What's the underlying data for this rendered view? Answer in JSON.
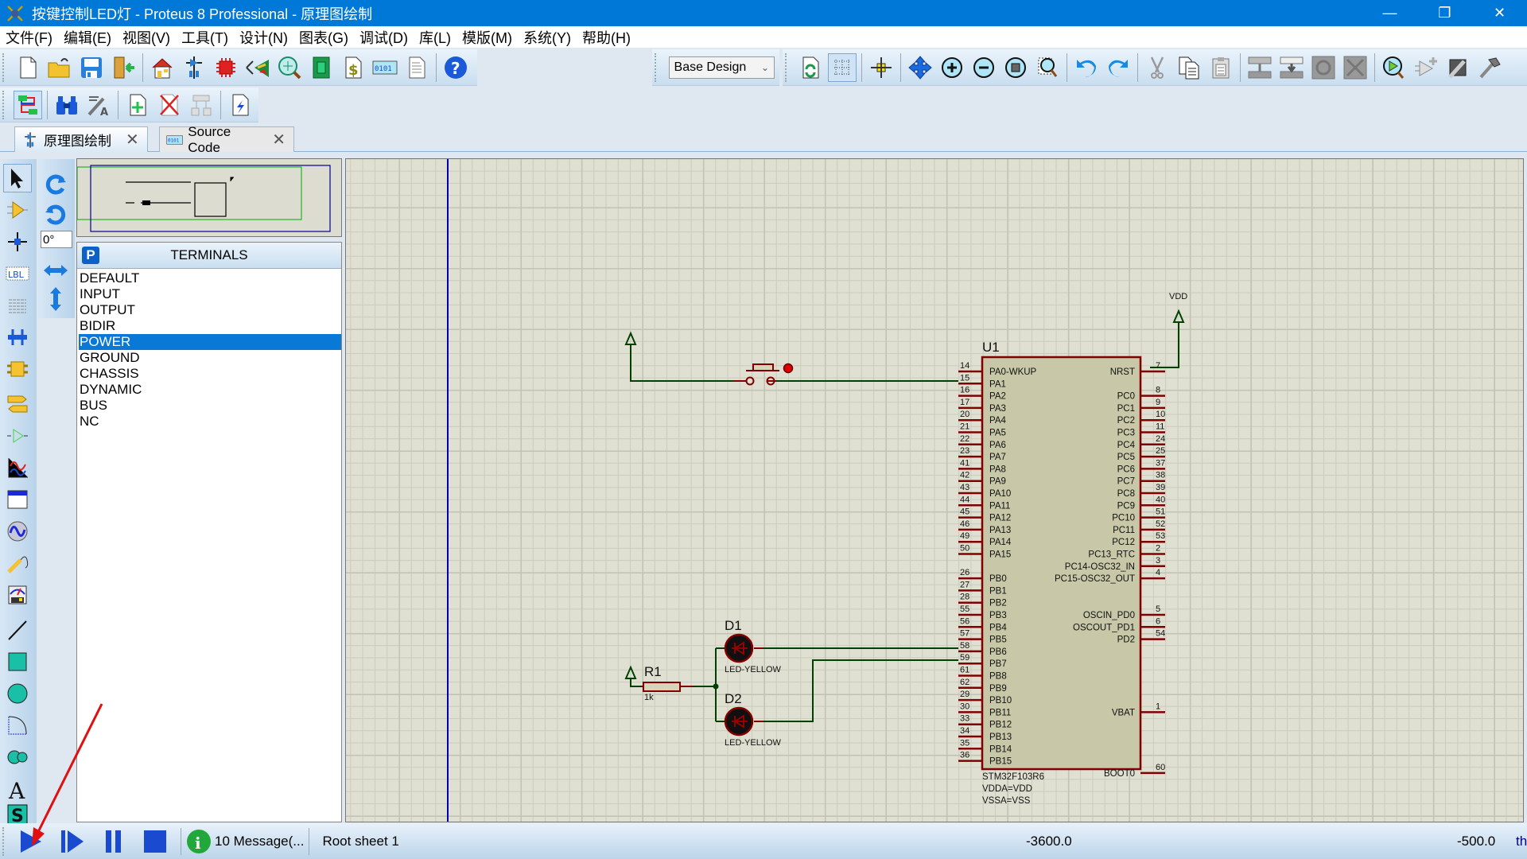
{
  "window": {
    "title": "按键控制LED灯 - Proteus 8 Professional - 原理图绘制",
    "minimize": "—",
    "restore": "❐",
    "close": "✕"
  },
  "menu": [
    "文件(F)",
    "编辑(E)",
    "视图(V)",
    "工具(T)",
    "设计(N)",
    "图表(G)",
    "调试(D)",
    "库(L)",
    "模版(M)",
    "系统(Y)",
    "帮助(H)"
  ],
  "toolbar": {
    "design_select": "Base Design",
    "row1_icons": [
      "new-file",
      "open-file",
      "save",
      "close-project",
      "home",
      "schematic-capture",
      "pcb-layout",
      "3d-visualizer",
      "gerber-viewer",
      "design-explorer",
      "bill-of-materials",
      "source-code",
      "notes",
      "help"
    ],
    "row1_right_icons": [
      "refresh",
      "grid-toggle",
      "origin",
      "pan",
      "zoom-in",
      "zoom-out",
      "zoom-all",
      "zoom-area",
      "undo",
      "redo",
      "cut",
      "copy",
      "paste",
      "block-copy",
      "block-move",
      "block-rotate",
      "block-delete",
      "pick-device",
      "make-device",
      "packaging-tool",
      "decompose"
    ],
    "row2_icons": [
      "sheet-navigation",
      "search",
      "property-assignment",
      "new-sheet",
      "remove-sheet",
      "goto-child-sheet",
      "electrical-rule-check"
    ]
  },
  "tabs": [
    {
      "label": "原理图绘制",
      "icon": "schematic-icon",
      "active": true
    },
    {
      "label": "Source Code",
      "icon": "source-code-icon",
      "active": false
    }
  ],
  "tools": {
    "rotation_angle": "0°",
    "left_tools": [
      "selection",
      "component",
      "junction-dot",
      "wire-label",
      "text-script",
      "buses",
      "subcircuit",
      "terminals",
      "device-pins",
      "graph",
      "active-popup",
      "generator",
      "probe",
      "virtual-instruments",
      "line",
      "box",
      "circle",
      "arc",
      "closed-path",
      "text",
      "symbol"
    ]
  },
  "terminals_panel": {
    "header_button": "P",
    "title": "TERMINALS",
    "items": [
      "DEFAULT",
      "INPUT",
      "OUTPUT",
      "BIDIR",
      "POWER",
      "GROUND",
      "CHASSIS",
      "DYNAMIC",
      "BUS",
      "NC"
    ],
    "selected": "POWER"
  },
  "schematic": {
    "u1": {
      "ref": "U1",
      "part": "STM32F103R6",
      "props": [
        "VDDA=VDD",
        "VSSA=VSS"
      ],
      "left_pins": [
        {
          "num": "14",
          "name": "PA0-WKUP"
        },
        {
          "num": "15",
          "name": "PA1"
        },
        {
          "num": "16",
          "name": "PA2"
        },
        {
          "num": "17",
          "name": "PA3"
        },
        {
          "num": "20",
          "name": "PA4"
        },
        {
          "num": "21",
          "name": "PA5"
        },
        {
          "num": "22",
          "name": "PA6"
        },
        {
          "num": "23",
          "name": "PA7"
        },
        {
          "num": "41",
          "name": "PA8"
        },
        {
          "num": "42",
          "name": "PA9"
        },
        {
          "num": "43",
          "name": "PA10"
        },
        {
          "num": "44",
          "name": "PA11"
        },
        {
          "num": "45",
          "name": "PA12"
        },
        {
          "num": "46",
          "name": "PA13"
        },
        {
          "num": "49",
          "name": "PA14"
        },
        {
          "num": "50",
          "name": "PA15"
        },
        null,
        {
          "num": "26",
          "name": "PB0"
        },
        {
          "num": "27",
          "name": "PB1"
        },
        {
          "num": "28",
          "name": "PB2"
        },
        {
          "num": "55",
          "name": "PB3"
        },
        {
          "num": "56",
          "name": "PB4"
        },
        {
          "num": "57",
          "name": "PB5"
        },
        {
          "num": "58",
          "name": "PB6"
        },
        {
          "num": "59",
          "name": "PB7"
        },
        {
          "num": "61",
          "name": "PB8"
        },
        {
          "num": "62",
          "name": "PB9"
        },
        {
          "num": "29",
          "name": "PB10"
        },
        {
          "num": "30",
          "name": "PB11"
        },
        {
          "num": "33",
          "name": "PB12"
        },
        {
          "num": "34",
          "name": "PB13"
        },
        {
          "num": "35",
          "name": "PB14"
        },
        {
          "num": "36",
          "name": "PB15"
        }
      ],
      "right_pins": [
        {
          "num": "7",
          "name": "NRST"
        },
        null,
        {
          "num": "8",
          "name": "PC0"
        },
        {
          "num": "9",
          "name": "PC1"
        },
        {
          "num": "10",
          "name": "PC2"
        },
        {
          "num": "11",
          "name": "PC3"
        },
        {
          "num": "24",
          "name": "PC4"
        },
        {
          "num": "25",
          "name": "PC5"
        },
        {
          "num": "37",
          "name": "PC6"
        },
        {
          "num": "38",
          "name": "PC7"
        },
        {
          "num": "39",
          "name": "PC8"
        },
        {
          "num": "40",
          "name": "PC9"
        },
        {
          "num": "51",
          "name": "PC10"
        },
        {
          "num": "52",
          "name": "PC11"
        },
        {
          "num": "53",
          "name": "PC12"
        },
        {
          "num": "2",
          "name": "PC13_RTC"
        },
        {
          "num": "3",
          "name": "PC14-OSC32_IN"
        },
        {
          "num": "4",
          "name": "PC15-OSC32_OUT"
        },
        null,
        null,
        {
          "num": "5",
          "name": "OSCIN_PD0"
        },
        {
          "num": "6",
          "name": "OSCOUT_PD1"
        },
        {
          "num": "54",
          "name": "PD2"
        },
        null,
        null,
        null,
        null,
        null,
        {
          "num": "1",
          "name": "VBAT"
        },
        null,
        null,
        null,
        null,
        {
          "num": "60",
          "name": "BOOT0"
        }
      ]
    },
    "vdd_label": "VDD",
    "r1": {
      "ref": "R1",
      "value": "1k"
    },
    "d1": {
      "ref": "D1",
      "value": "LED-YELLOW"
    },
    "d2": {
      "ref": "D2",
      "value": "LED-YELLOW"
    }
  },
  "status": {
    "messages": "10 Message(...",
    "sheet": "Root sheet 1",
    "coord_x": "-3600.0",
    "coord_y": "-500.0",
    "units": "th"
  },
  "colors": {
    "titlebar": "#0078d7",
    "wire": "#004000",
    "component": "#800000",
    "ic_fill": "#c8c8a8",
    "selection": "#0a78d7",
    "canvas": "#e0e0d2"
  }
}
